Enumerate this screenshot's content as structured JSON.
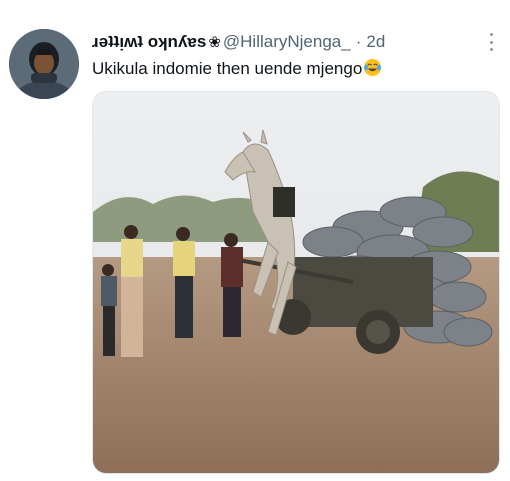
{
  "author": {
    "display_name": "ɹəʇʇᴉʍʇ oʞnʎɐs",
    "handle": "@HillaryNjenga_",
    "separator": "·",
    "time": "2d"
  },
  "tweet": {
    "text": "Ukikula indomie then uende mjengo"
  },
  "icons": {
    "name_decoration": "flower-icon",
    "emoji": "face-with-tears-of-joy-icon",
    "menu": "more-options-icon"
  },
  "colors": {
    "text_primary": "#0f1419",
    "text_secondary": "#536471"
  }
}
